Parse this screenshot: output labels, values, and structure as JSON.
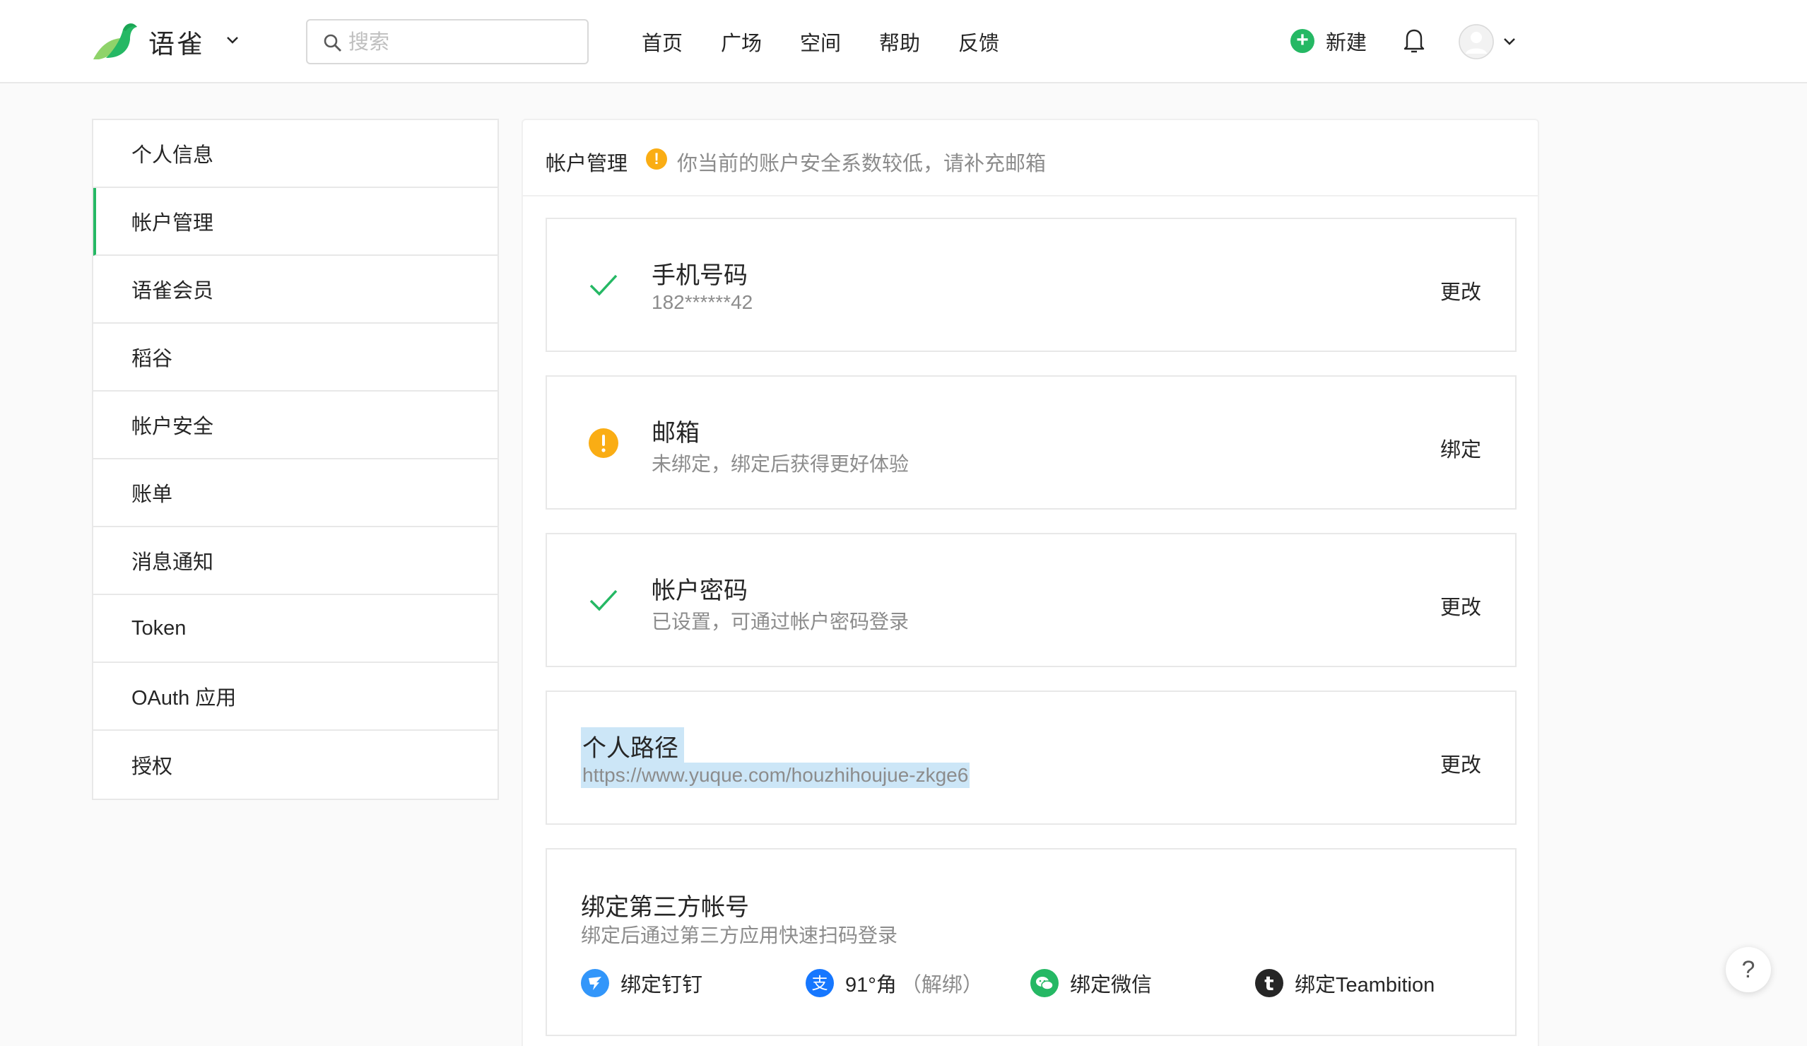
{
  "header": {
    "brand": "语雀",
    "search_placeholder": "搜索",
    "nav": [
      "首页",
      "广场",
      "空间",
      "帮助",
      "反馈"
    ],
    "new_label": "新建"
  },
  "sidebar": {
    "items": [
      {
        "label": "个人信息"
      },
      {
        "label": "帐户管理",
        "active": true
      },
      {
        "label": "语雀会员"
      },
      {
        "label": "稻谷"
      },
      {
        "label": "帐户安全"
      },
      {
        "label": "账单"
      },
      {
        "label": "消息通知"
      },
      {
        "label": "Token"
      },
      {
        "label": "OAuth 应用"
      },
      {
        "label": "授权"
      }
    ]
  },
  "main": {
    "title": "帐户管理",
    "warning_icon_text": "!",
    "warning": "你当前的账户安全系数较低，请补充邮箱",
    "phone": {
      "title": "手机号码",
      "value": "182******42",
      "action": "更改",
      "icon": "check-icon"
    },
    "email": {
      "title": "邮箱",
      "desc": "未绑定，绑定后获得更好体验",
      "action": "绑定",
      "icon": "warning-icon"
    },
    "password": {
      "title": "帐户密码",
      "desc": "已设置，可通过帐户密码登录",
      "action": "更改",
      "icon": "check-icon"
    },
    "path": {
      "title": "个人路径",
      "url": "https://www.yuque.com/houzhihoujue-zkge6",
      "action": "更改"
    },
    "third_party": {
      "title": "绑定第三方帐号",
      "desc": "绑定后通过第三方应用快速扫码登录",
      "items": [
        {
          "label": "绑定钉钉",
          "icon": "dingtalk-icon",
          "color": "#3296fa"
        },
        {
          "label": "91°角",
          "unbind": "（解绑）",
          "icon": "alipay-icon",
          "color": "#1677ff"
        },
        {
          "label": "绑定微信",
          "icon": "wechat-icon",
          "color": "#25b864"
        },
        {
          "label": "绑定Teambition",
          "icon": "teambition-icon",
          "color": "#262626"
        }
      ]
    }
  },
  "help_label": "?",
  "colors": {
    "accent": "#25b864",
    "warning": "#faad14",
    "selection": "#cce6f7"
  }
}
